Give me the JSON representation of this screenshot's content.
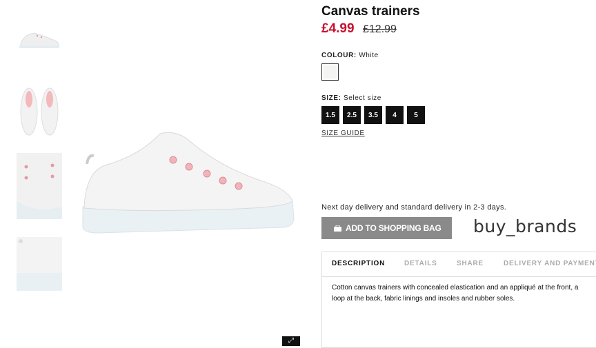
{
  "product": {
    "title": "Canvas trainers",
    "price_current": "£4.99",
    "price_old": "£12.99"
  },
  "colour": {
    "label": "COLOUR:",
    "value": "White",
    "swatch_color": "#f4f4f2"
  },
  "size": {
    "label": "SIZE:",
    "value": "Select size",
    "options": [
      "1.5",
      "2.5",
      "3.5",
      "4",
      "5"
    ],
    "guide_label": "SIZE GUIDE"
  },
  "delivery_text": "Next day delivery and standard delivery in 2-3 days.",
  "add_to_bag_label": "ADD TO SHOPPING BAG",
  "watermark": "buy_brands",
  "tabs": [
    "DESCRIPTION",
    "DETAILS",
    "SHARE",
    "DELIVERY AND PAYMENT"
  ],
  "description_line1": "Cotton canvas trainers with concealed elastication and an appliqué at the front, a",
  "description_line2": "loop at the back, fabric linings and insoles and rubber soles.",
  "colors": {
    "price_accent": "#c8102e",
    "button_bg": "#8a8a8a",
    "size_bg": "#111111"
  }
}
